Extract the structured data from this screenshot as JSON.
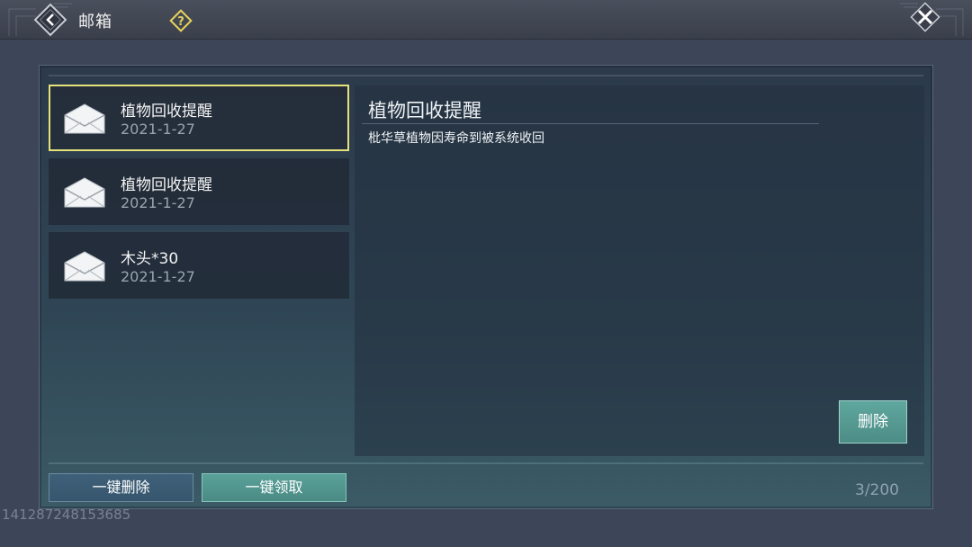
{
  "header": {
    "title": "邮箱",
    "back_icon": "back-arrow-icon",
    "help_icon": "help-icon",
    "close_icon": "close-icon"
  },
  "mail_list": [
    {
      "name": "植物回收提醒",
      "date": "2021-1-27",
      "selected": true,
      "icon": "envelope-icon"
    },
    {
      "name": "植物回收提醒",
      "date": "2021-1-27",
      "selected": false,
      "icon": "envelope-icon"
    },
    {
      "name": "木头*30",
      "date": "2021-1-27",
      "selected": false,
      "icon": "envelope-icon"
    }
  ],
  "detail": {
    "title": "植物回收提醒",
    "body": "枇华草植物因寿命到被系统收回",
    "delete_label": "删除"
  },
  "footer": {
    "delete_all_label": "一键删除",
    "claim_all_label": "一键领取",
    "mail_count": "3/200"
  },
  "uid": "141287248153685",
  "colors": {
    "selected_border": "#e6e27a",
    "accent_teal": "#5aa199",
    "help_yellow": "#e8d35a"
  }
}
